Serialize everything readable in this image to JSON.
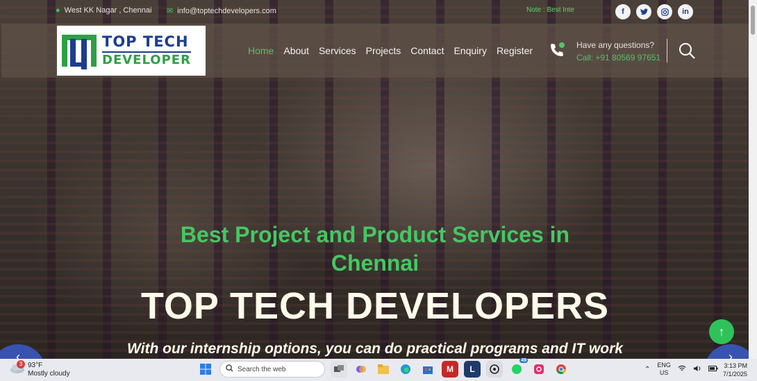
{
  "topbar": {
    "location": "West KK Nagar , Chennai",
    "email": "info@toptechdevelopers.com",
    "note": "Note : Best Inte",
    "social": [
      "f",
      "t",
      "ig",
      "in"
    ]
  },
  "logo": {
    "line1": "TOP TECH",
    "line2": "DEVELOPER"
  },
  "nav": {
    "items": [
      "Home",
      "About",
      "Services",
      "Projects",
      "Contact",
      "Enquiry",
      "Register"
    ],
    "active": "Home"
  },
  "contact": {
    "question": "Have any questions?",
    "call": "Call: +91 80569 97651"
  },
  "hero": {
    "subtitle": "Best Project and Product Services in Chennai",
    "title": "TOP TECH DEVELOPERS",
    "tagline": "With our internship options, you can do practical programs and IT work"
  },
  "taskbar": {
    "weather_temp": "93°F",
    "weather_desc": "Mostly cloudy",
    "weather_badge": "3",
    "search_placeholder": "Search the web",
    "whatsapp_badge": "49",
    "lang_top": "ENG",
    "lang_bottom": "US",
    "time": "3:13 PM",
    "date": "7/1/2025"
  },
  "colors": {
    "accent_green": "#44c863",
    "brand_blue": "#1c3d8f",
    "top_button": "#2fc25a"
  }
}
